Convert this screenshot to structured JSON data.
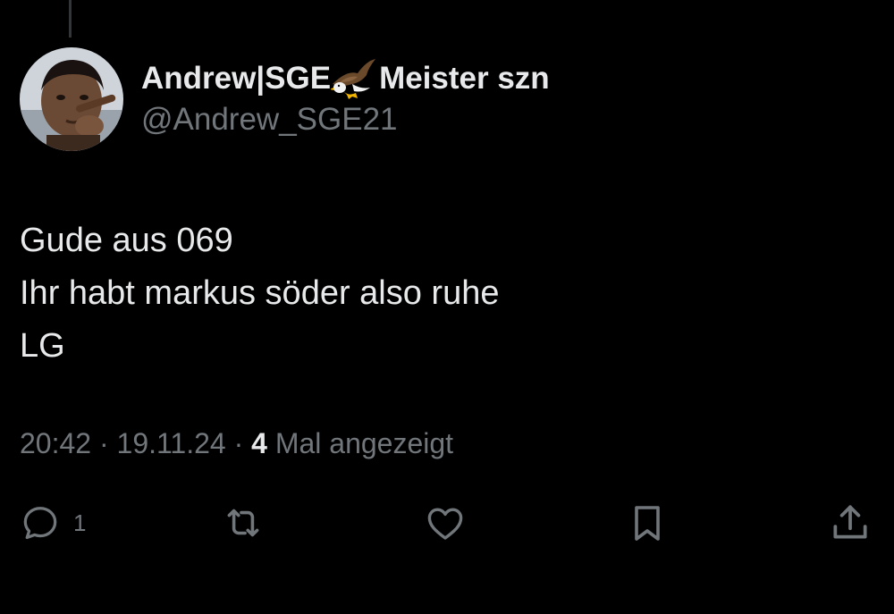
{
  "author": {
    "display_name_prefix": "Andrew|SGE",
    "display_name_suffix": "Meister szn",
    "emoji": "eagle",
    "handle": "@Andrew_SGE21"
  },
  "tweet": {
    "lines": [
      "Gude aus 069",
      "Ihr habt markus söder also ruhe",
      "LG"
    ]
  },
  "meta": {
    "time": "20:42",
    "separator": "·",
    "date": "19.11.24",
    "views_count": "4",
    "views_label": "Mal angezeigt"
  },
  "actions": {
    "reply_count": "1",
    "icons": [
      "reply-icon",
      "retweet-icon",
      "like-icon",
      "bookmark-icon",
      "share-icon"
    ]
  },
  "colors": {
    "background": "#000000",
    "primary_text": "#e7e9ea",
    "secondary_text": "#71767b",
    "thread_line": "#333639"
  }
}
